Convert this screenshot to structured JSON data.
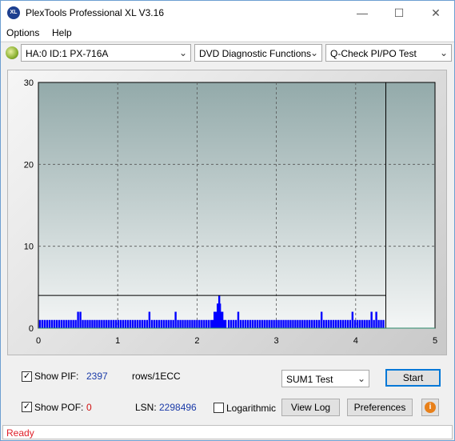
{
  "window": {
    "title": "PlexTools Professional XL V3.16",
    "icon_text": "XL"
  },
  "controls": {
    "minimize": "—",
    "maximize": "☐",
    "close": "✕"
  },
  "menu": [
    {
      "label": "Options",
      "mnemonic": "O"
    },
    {
      "label": "Help",
      "mnemonic": "H"
    }
  ],
  "toolbar": {
    "drive": "HA:0 ID:1  PX-716A",
    "function": "DVD Diagnostic Functions",
    "test": "Q-Check PI/PO Test"
  },
  "chart_data": {
    "type": "bar",
    "xlim": [
      0,
      5
    ],
    "ylim": [
      0,
      30
    ],
    "x_ticks": [
      "0",
      "1",
      "2",
      "3",
      "4",
      "5"
    ],
    "y_ticks": [
      "0",
      "10",
      "20",
      "30"
    ],
    "grid": true,
    "threshold_line": 4,
    "test_end_x": 4.38,
    "bar_color": "#0000ff",
    "series": [
      {
        "values": [
          [
            0.02,
            1
          ],
          [
            0.05,
            1
          ],
          [
            0.08,
            1
          ],
          [
            0.11,
            1
          ],
          [
            0.14,
            1
          ],
          [
            0.17,
            1
          ],
          [
            0.2,
            1
          ],
          [
            0.23,
            1
          ],
          [
            0.26,
            1
          ],
          [
            0.29,
            1
          ],
          [
            0.32,
            1
          ],
          [
            0.35,
            1
          ],
          [
            0.38,
            1
          ],
          [
            0.41,
            1
          ],
          [
            0.44,
            1
          ],
          [
            0.47,
            1
          ],
          [
            0.5,
            2
          ],
          [
            0.53,
            2
          ],
          [
            0.56,
            1
          ],
          [
            0.59,
            1
          ],
          [
            0.62,
            1
          ],
          [
            0.65,
            1
          ],
          [
            0.68,
            1
          ],
          [
            0.71,
            1
          ],
          [
            0.74,
            1
          ],
          [
            0.77,
            1
          ],
          [
            0.8,
            1
          ],
          [
            0.83,
            1
          ],
          [
            0.86,
            1
          ],
          [
            0.89,
            1
          ],
          [
            0.92,
            1
          ],
          [
            0.95,
            1
          ],
          [
            0.98,
            1
          ],
          [
            1.01,
            1
          ],
          [
            1.04,
            1
          ],
          [
            1.07,
            1
          ],
          [
            1.1,
            1
          ],
          [
            1.13,
            1
          ],
          [
            1.16,
            1
          ],
          [
            1.19,
            1
          ],
          [
            1.22,
            1
          ],
          [
            1.25,
            1
          ],
          [
            1.28,
            1
          ],
          [
            1.31,
            1
          ],
          [
            1.34,
            1
          ],
          [
            1.37,
            1
          ],
          [
            1.4,
            2
          ],
          [
            1.43,
            1
          ],
          [
            1.46,
            1
          ],
          [
            1.49,
            1
          ],
          [
            1.52,
            1
          ],
          [
            1.55,
            1
          ],
          [
            1.58,
            1
          ],
          [
            1.61,
            1
          ],
          [
            1.64,
            1
          ],
          [
            1.67,
            1
          ],
          [
            1.7,
            1
          ],
          [
            1.73,
            2
          ],
          [
            1.76,
            1
          ],
          [
            1.79,
            1
          ],
          [
            1.82,
            1
          ],
          [
            1.85,
            1
          ],
          [
            1.88,
            1
          ],
          [
            1.91,
            1
          ],
          [
            1.94,
            1
          ],
          [
            1.97,
            1
          ],
          [
            2.0,
            1
          ],
          [
            2.03,
            1
          ],
          [
            2.06,
            1
          ],
          [
            2.09,
            1
          ],
          [
            2.12,
            1
          ],
          [
            2.15,
            1
          ],
          [
            2.18,
            1
          ],
          [
            2.2,
            1
          ],
          [
            2.22,
            2
          ],
          [
            2.24,
            2
          ],
          [
            2.26,
            3
          ],
          [
            2.27,
            3
          ],
          [
            2.28,
            4
          ],
          [
            2.29,
            3
          ],
          [
            2.3,
            2
          ],
          [
            2.32,
            2
          ],
          [
            2.34,
            1
          ],
          [
            2.36,
            1
          ],
          [
            2.4,
            1
          ],
          [
            2.43,
            1
          ],
          [
            2.46,
            1
          ],
          [
            2.49,
            1
          ],
          [
            2.52,
            2
          ],
          [
            2.55,
            1
          ],
          [
            2.58,
            1
          ],
          [
            2.61,
            1
          ],
          [
            2.64,
            1
          ],
          [
            2.67,
            1
          ],
          [
            2.7,
            1
          ],
          [
            2.73,
            1
          ],
          [
            2.76,
            1
          ],
          [
            2.79,
            1
          ],
          [
            2.82,
            1
          ],
          [
            2.85,
            1
          ],
          [
            2.88,
            1
          ],
          [
            2.91,
            1
          ],
          [
            2.94,
            1
          ],
          [
            2.97,
            1
          ],
          [
            3.0,
            1
          ],
          [
            3.03,
            1
          ],
          [
            3.06,
            1
          ],
          [
            3.09,
            1
          ],
          [
            3.12,
            1
          ],
          [
            3.15,
            1
          ],
          [
            3.18,
            1
          ],
          [
            3.21,
            1
          ],
          [
            3.24,
            1
          ],
          [
            3.27,
            1
          ],
          [
            3.3,
            1
          ],
          [
            3.33,
            1
          ],
          [
            3.36,
            1
          ],
          [
            3.39,
            1
          ],
          [
            3.42,
            1
          ],
          [
            3.45,
            1
          ],
          [
            3.48,
            1
          ],
          [
            3.51,
            1
          ],
          [
            3.54,
            1
          ],
          [
            3.57,
            2
          ],
          [
            3.6,
            1
          ],
          [
            3.63,
            1
          ],
          [
            3.66,
            1
          ],
          [
            3.69,
            1
          ],
          [
            3.72,
            1
          ],
          [
            3.75,
            1
          ],
          [
            3.78,
            1
          ],
          [
            3.81,
            1
          ],
          [
            3.84,
            1
          ],
          [
            3.87,
            1
          ],
          [
            3.9,
            1
          ],
          [
            3.93,
            1
          ],
          [
            3.96,
            2
          ],
          [
            3.99,
            1
          ],
          [
            4.02,
            1
          ],
          [
            4.05,
            1
          ],
          [
            4.08,
            1
          ],
          [
            4.11,
            1
          ],
          [
            4.14,
            1
          ],
          [
            4.17,
            1
          ],
          [
            4.2,
            2
          ],
          [
            4.23,
            1
          ],
          [
            4.26,
            2
          ],
          [
            4.29,
            1
          ],
          [
            4.32,
            1
          ],
          [
            4.35,
            1
          ]
        ]
      }
    ]
  },
  "stats": {
    "show_pif_label": "Show PIF:",
    "pif_value": "2397",
    "pif_unit": "rows/1ECC",
    "show_pof_label": "Show POF:",
    "pof_value": "0",
    "lsn_label": "LSN:",
    "lsn_value": "2298496",
    "logarithmic_label": "Logarithmic",
    "pif_checked": "✓",
    "pof_checked": "✓"
  },
  "actions": {
    "test_select": "SUM1 Test",
    "start": "Start",
    "view_log": "View Log",
    "preferences": "Preferences",
    "info_icon": "i"
  },
  "status": {
    "text": "Ready"
  },
  "colors": {
    "status_text": "#e0202a",
    "value_text": "#1a3aa8",
    "pof_value": "#d01010"
  }
}
